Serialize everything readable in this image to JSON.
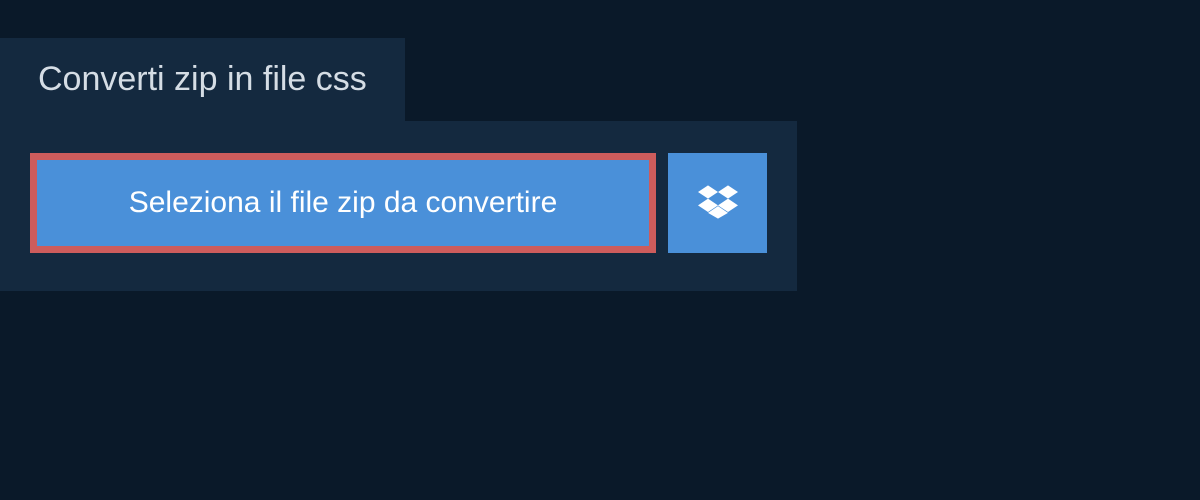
{
  "header": {
    "tab_title": "Converti zip in file css"
  },
  "actions": {
    "select_file_label": "Seleziona il file zip da convertire",
    "dropbox_icon": "dropbox-icon"
  },
  "colors": {
    "background_dark": "#0a1929",
    "panel": "#14293f",
    "button": "#4a90d9",
    "highlight_border": "#cd5c5c",
    "text_light": "#d5dde5"
  }
}
